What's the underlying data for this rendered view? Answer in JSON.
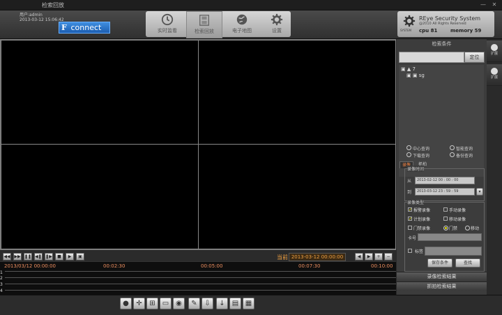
{
  "window": {
    "title": "检索回放",
    "minimize": "—",
    "close": "✕"
  },
  "login": {
    "line1": "用户:admin",
    "line2": "2013-03-12 15:06:42"
  },
  "connect": {
    "f": "F",
    "label": "connect"
  },
  "nav": [
    {
      "label": "实时监看",
      "icon": "clock-icon"
    },
    {
      "label": "检索回放",
      "icon": "film-icon"
    },
    {
      "label": "电子地图",
      "icon": "globe-icon"
    },
    {
      "label": "设置",
      "icon": "gear-icon"
    }
  ],
  "sysinfo": {
    "brand": "SYSTEM",
    "title": "REye Security System",
    "copyright": "@2010 All Rights Reserved",
    "cpu": "cpu  81",
    "memory": "memory  59"
  },
  "controls": {
    "current_label": "当前",
    "current_time": "2013-03-12 00:00:00"
  },
  "timeline": {
    "ticks": [
      "2013/03/12 00:00:00",
      "00:02:30",
      "00:05:00",
      "00:07:30",
      "00:10:00"
    ],
    "rows": [
      "1",
      "2",
      "3",
      "4"
    ]
  },
  "panel": {
    "header": "检索条件",
    "locate": "定位",
    "tree": [
      "7",
      "sg"
    ],
    "query_opts": [
      "中心查询",
      "智能查询",
      "下载查询",
      "备份查询"
    ],
    "tabs": [
      "录像",
      "抓拍"
    ],
    "rec_time": {
      "title": "录像时间",
      "from_label": "从",
      "from": "2013-02-12 00 : 00 : 00",
      "to_label": "到",
      "to": "2013-03-12 23 : 59 : 59"
    },
    "rec_type": {
      "title": "录像类型",
      "alarm": "报警录像",
      "manual": "手动录像",
      "plan": "计划录像",
      "motion": "移动录像",
      "door": "门禁录像",
      "door_r": "门禁",
      "other_r": "移动",
      "card_label": "卡号"
    },
    "tag": "标签",
    "save_cond": "保存条件",
    "search": "查找",
    "results1": "录像检索结果",
    "results2": "抓拍检索结果"
  },
  "strip": [
    {
      "label": "扩展"
    },
    {
      "label": "扩展"
    }
  ]
}
